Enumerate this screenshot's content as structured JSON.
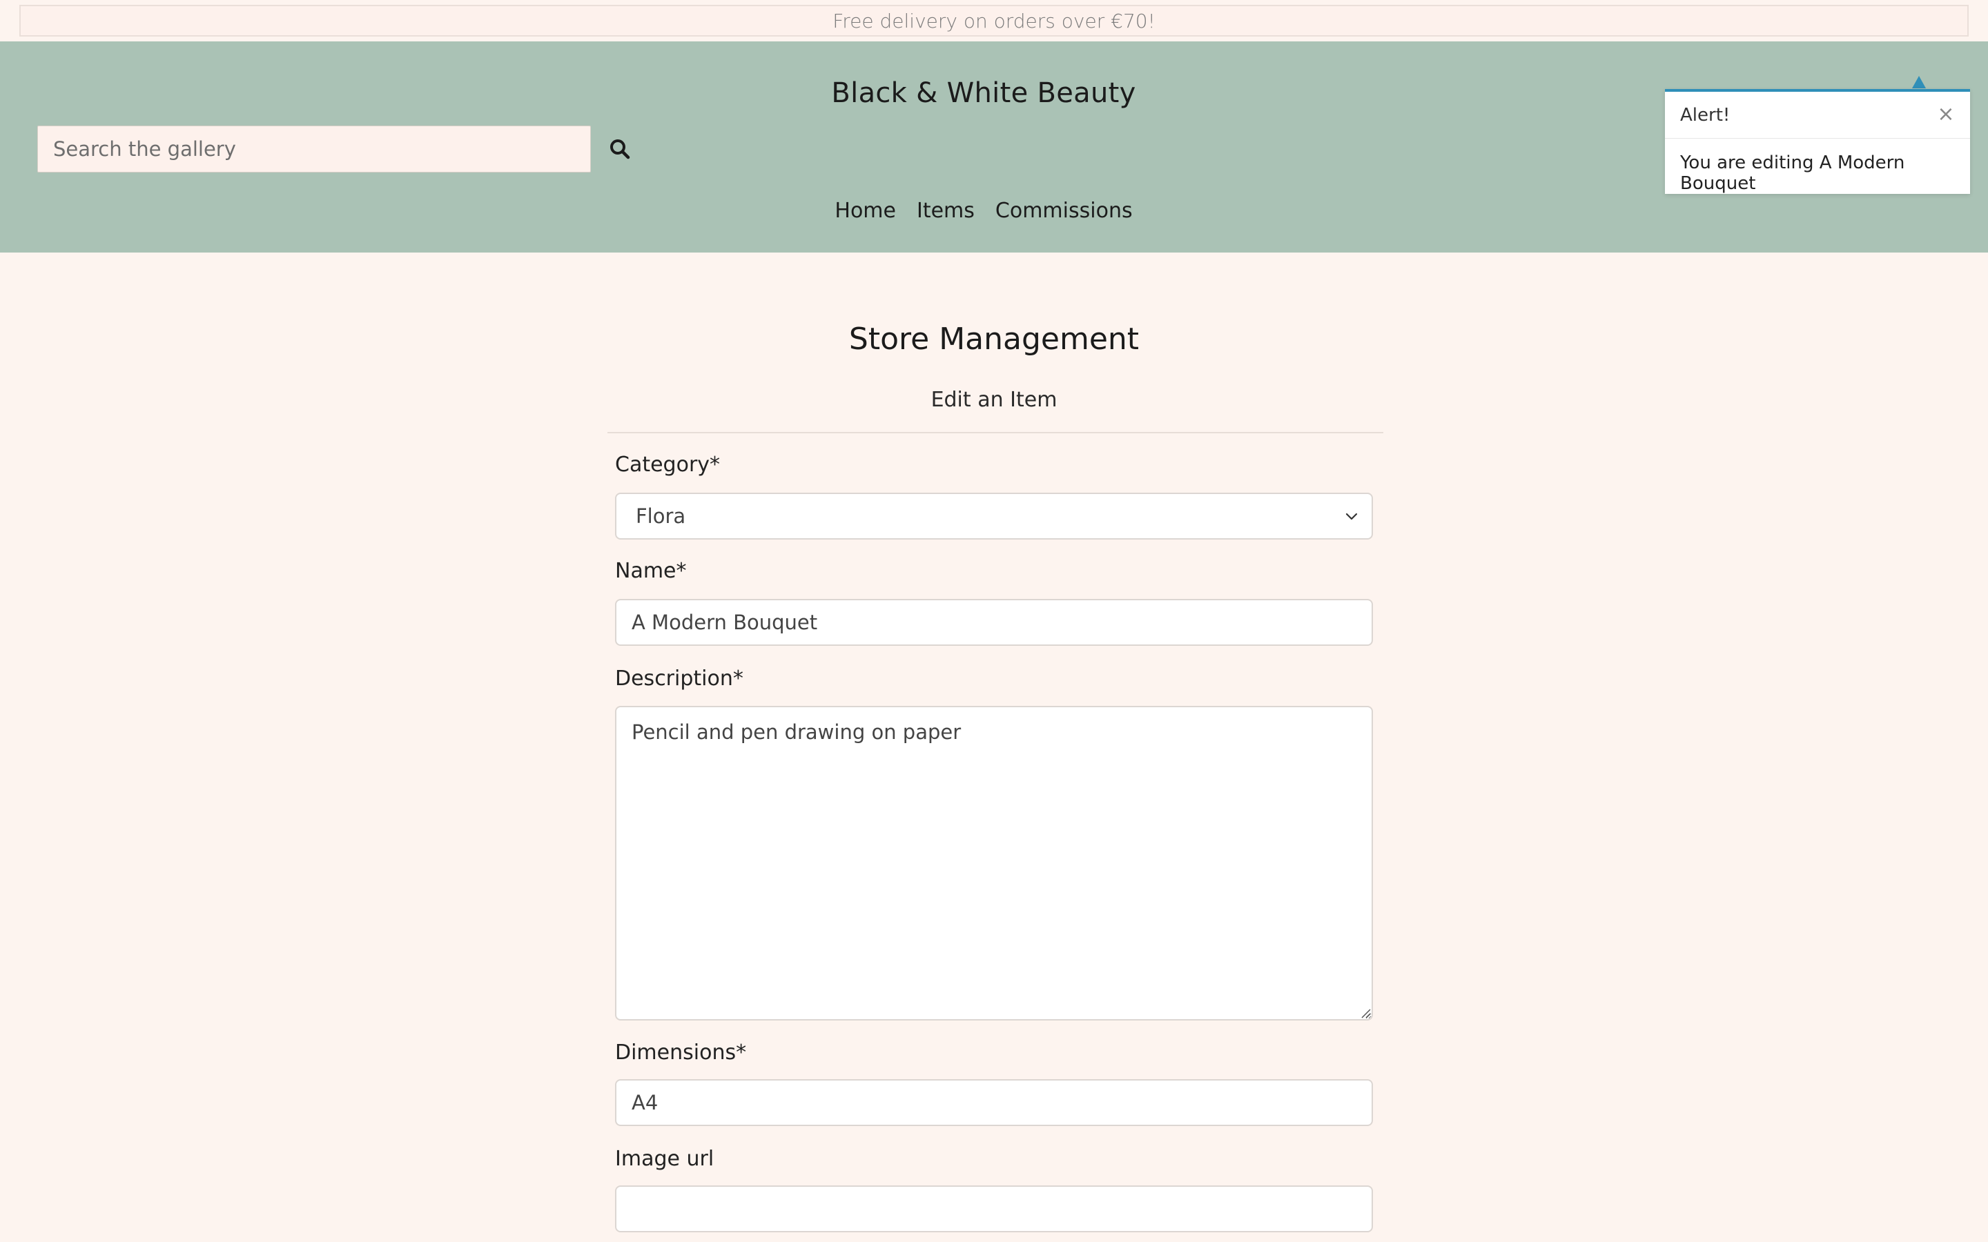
{
  "banner": {
    "text": "Free delivery on orders over €70!"
  },
  "header": {
    "brand": "Black & White Beauty",
    "search": {
      "placeholder": "Search the gallery",
      "value": ""
    },
    "search_icon": "magnifier-icon",
    "nav": [
      {
        "label": "Home"
      },
      {
        "label": "Items"
      },
      {
        "label": "Commissions"
      }
    ]
  },
  "toast": {
    "title": "Alert!",
    "close_glyph": "×",
    "message": "You are editing A Modern Bouquet",
    "accent_color": "#2f8fb8"
  },
  "main": {
    "title": "Store Management",
    "subtitle": "Edit an Item",
    "form": {
      "category": {
        "label": "Category*",
        "selected": "Flora"
      },
      "name": {
        "label": "Name*",
        "value": "A Modern Bouquet"
      },
      "description": {
        "label": "Description*",
        "value": "Pencil and pen drawing on paper"
      },
      "dimensions": {
        "label": "Dimensions*",
        "value": "A4"
      },
      "image_url": {
        "label": "Image url",
        "value": ""
      }
    }
  },
  "colors": {
    "header_bg": "#aac2b5",
    "page_bg": "#fdf4ef",
    "banner_bg": "#fdf1ec"
  }
}
